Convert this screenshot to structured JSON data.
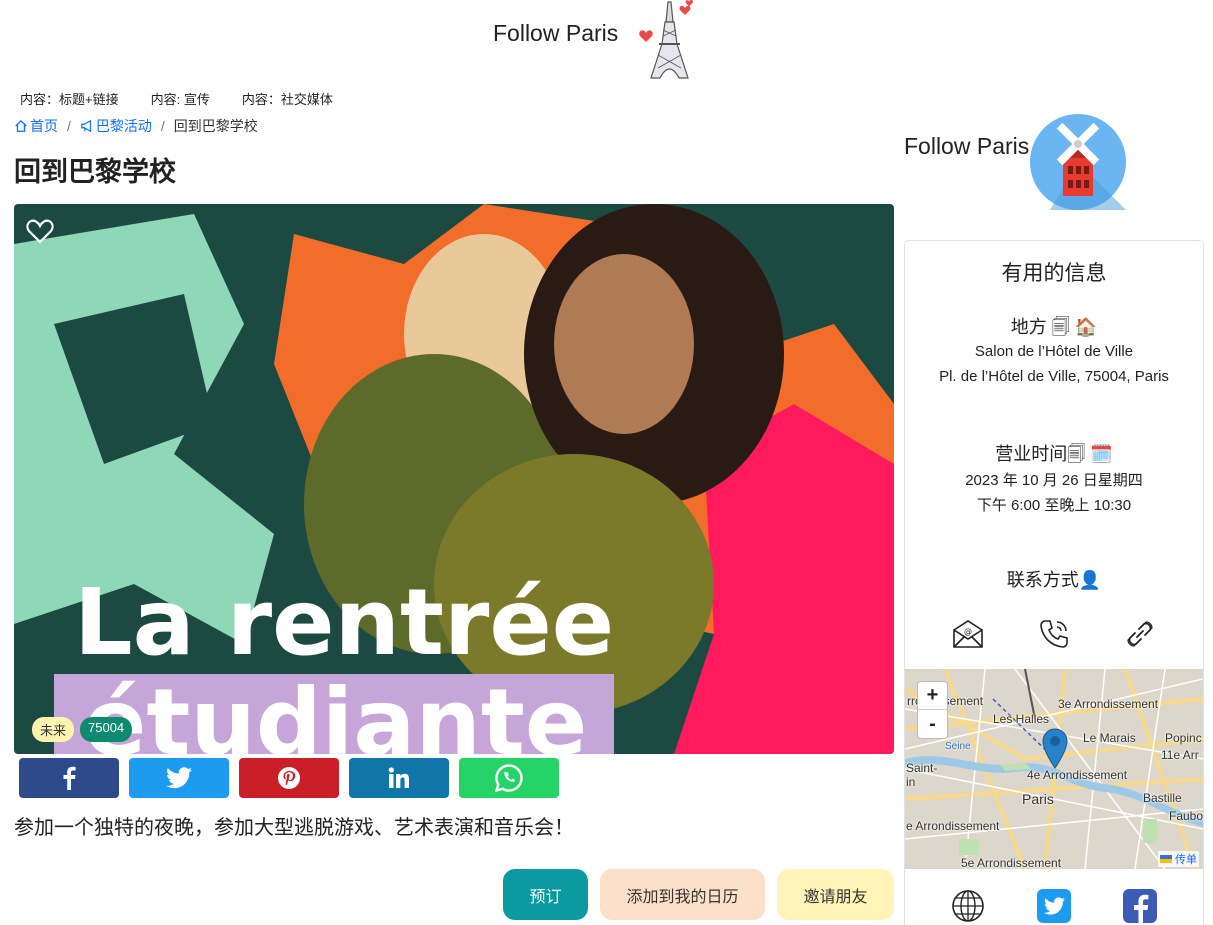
{
  "header": {
    "brand": "Follow Paris"
  },
  "content_nav": [
    {
      "label": "内容：标题+链接"
    },
    {
      "label": "内容: 宣传"
    },
    {
      "label": "内容：社交媒体"
    }
  ],
  "breadcrumb": {
    "home": "首页",
    "category": "巴黎活动",
    "current": "回到巴黎学校"
  },
  "page_title": "回到巴黎学校",
  "hero": {
    "headline_line1": "La rentrée",
    "headline_line2": "étudiante",
    "badges": {
      "status": "未来",
      "postcode": "75004"
    }
  },
  "description": "参加一个独特的夜晚，参加大型逃脱游戏、艺术表演和音乐会！",
  "actions": {
    "book": "预订",
    "calendar": "添加到我的日历",
    "invite": "邀请朋友"
  },
  "sidebar": {
    "brand": "Follow Paris",
    "card_title": "有用的信息",
    "place": {
      "heading": "地方 🗐 🏠",
      "name": "Salon de l’Hôtel de Ville",
      "address": "Pl. de l’Hôtel de Ville, 75004, Paris"
    },
    "hours": {
      "heading": "营业时间🗐 🗓️",
      "date": "2023 年 10 月 26 日星期四",
      "time": "下午 6:00 至晚上 10:30"
    },
    "contact": {
      "heading": "联系方式👤"
    },
    "map": {
      "labels": [
        "Les Halles",
        "3e Arrondissement",
        "Le Marais",
        "4e Arrondissement",
        "Paris",
        "Bastille",
        "Saint-",
        "11e Arr",
        "Popinc",
        "Faubo",
        "5e Arrondissement",
        "e Arrondissement",
        "rrondissement",
        "Seine",
        "in"
      ],
      "attribution": "传单",
      "zoom_in": "+",
      "zoom_out": "-"
    }
  },
  "colors": {
    "link": "#0d6efd",
    "facebook": "#2d4a8c",
    "twitter": "#1d9bf0",
    "pinterest": "#cb1f27",
    "linkedin": "#0e76a8",
    "whatsapp": "#25d366",
    "book": "#0a9aa0",
    "calendar": "#fde0c8",
    "invite": "#fff5b8",
    "badge_zip": "#0d8a70"
  },
  "icons": [
    "heart-icon",
    "home-icon",
    "megaphone-icon",
    "eiffel-tower-icon",
    "windmill-icon",
    "email-icon",
    "phone-icon",
    "link-icon",
    "globe-icon",
    "twitter-icon",
    "facebook-icon",
    "map-marker-icon"
  ]
}
